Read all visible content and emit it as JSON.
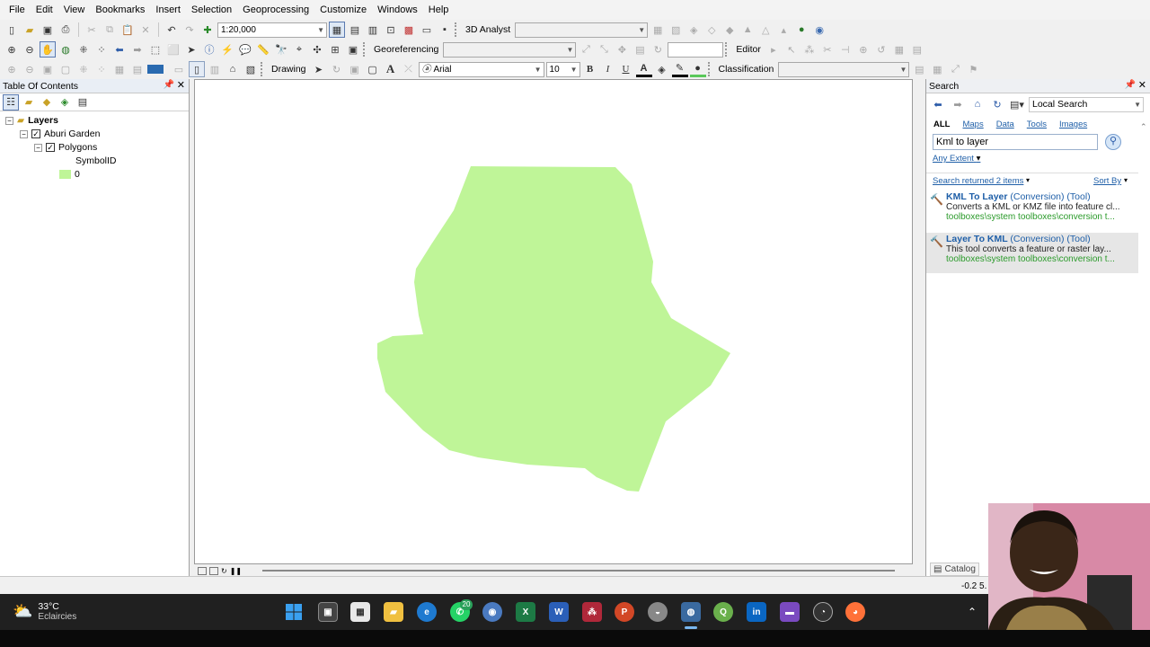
{
  "menu": [
    "File",
    "Edit",
    "View",
    "Bookmarks",
    "Insert",
    "Selection",
    "Geoprocessing",
    "Customize",
    "Windows",
    "Help"
  ],
  "toolbar1": {
    "scale": "1:20,000",
    "analyst_label": "3D Analyst"
  },
  "toolbar2": {
    "georef_label": "Georeferencing",
    "editor_label": "Editor"
  },
  "toolbar3": {
    "drawing_label": "Drawing",
    "font": "Arial",
    "font_size": "10",
    "bold": "B",
    "italic": "I",
    "underline": "U",
    "classification_label": "Classification"
  },
  "toc": {
    "title": "Table Of Contents",
    "layers_label": "Layers",
    "dataframe": "Aburi Garden",
    "layer": "Polygons",
    "field": "SymbolID",
    "legend_value": "0",
    "legend_color": "#bff598"
  },
  "map": {
    "polygon_color": "#bff598"
  },
  "search": {
    "title": "Search",
    "scope": "Local Search",
    "tabs": [
      "ALL",
      "Maps",
      "Data",
      "Tools",
      "Images"
    ],
    "query": "Kml to layer",
    "extent": "Any Extent",
    "returned": "Search returned 2 items",
    "sort": "Sort By",
    "results": [
      {
        "title": "KML To Layer",
        "category": "(Conversion)",
        "type": "(Tool)",
        "desc": "Converts a KML or KMZ file into feature cl...",
        "path": "toolboxes\\system toolboxes\\conversion t..."
      },
      {
        "title": "Layer To KML",
        "category": "(Conversion)",
        "type": "(Tool)",
        "desc": "This tool converts a feature or raster lay...",
        "path": "toolboxes\\system toolboxes\\conversion t..."
      }
    ],
    "catalog_tab": "Catalog"
  },
  "status": {
    "coords": "-0.2  5."
  },
  "weather": {
    "temp": "33°C",
    "desc": "Eclaircies"
  },
  "taskbar": {
    "whatsapp_badge": "20"
  }
}
